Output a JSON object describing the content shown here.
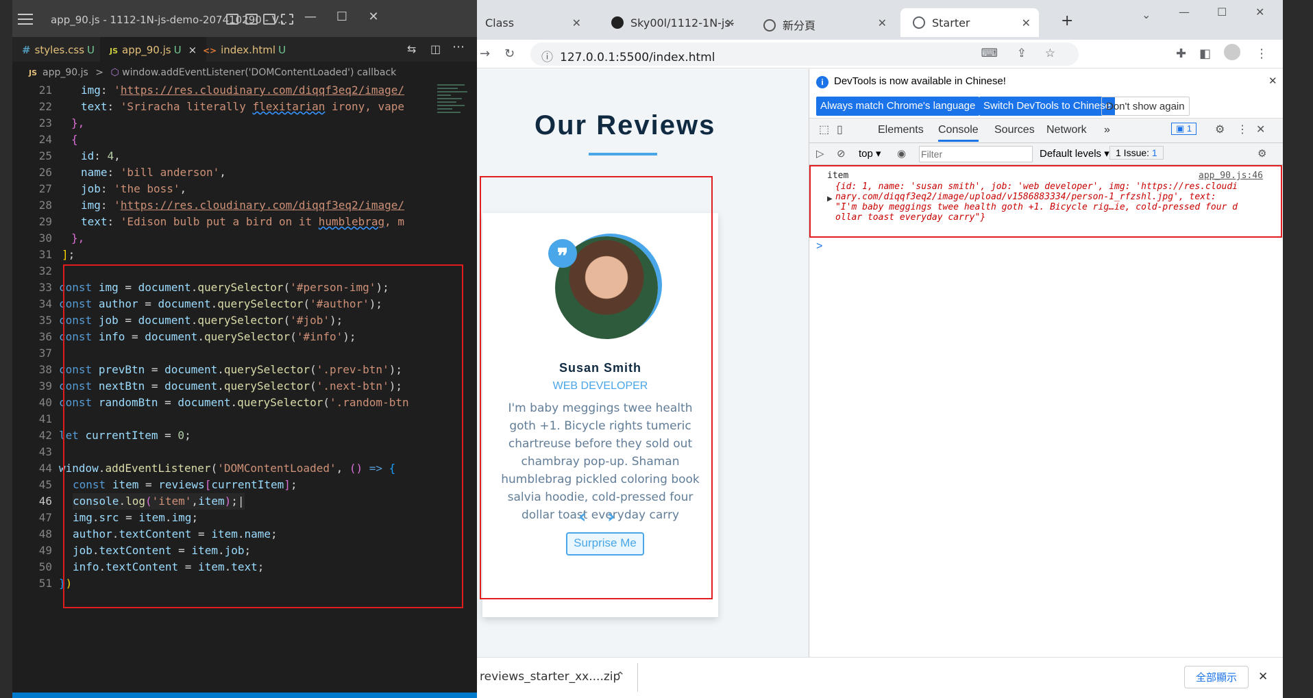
{
  "vscode": {
    "window_title": "app_90.js - 1112-1N-js-demo-207410290 - V...",
    "tabs": [
      {
        "icon": "#",
        "label": "styles.css",
        "status": "U"
      },
      {
        "icon": "JS",
        "label": "app_90.js",
        "status": "U",
        "close": "×"
      },
      {
        "icon": "<>",
        "label": "index.html",
        "status": "U"
      }
    ],
    "breadcrumb": {
      "file_icon": "JS",
      "file": "app_90.js",
      "sep": ">",
      "symbol": "window.addEventListener('DOMContentLoaded') callback"
    },
    "line_numbers": [
      "21",
      "22",
      "23",
      "24",
      "25",
      "26",
      "27",
      "28",
      "29",
      "30",
      "31",
      "32",
      "33",
      "34",
      "35",
      "36",
      "37",
      "38",
      "39",
      "40",
      "41",
      "42",
      "43",
      "44",
      "45",
      "46",
      "47",
      "48",
      "49",
      "50",
      "51"
    ],
    "current_line": "46"
  },
  "chrome": {
    "tabs": [
      {
        "label": "Class"
      },
      {
        "label": "Sky00l/1112-1N-js-"
      },
      {
        "label": "新分頁"
      },
      {
        "label": "Starter"
      }
    ],
    "new_tab": "+",
    "url": "127.0.0.1:5500/index.html"
  },
  "page": {
    "heading": "Our Reviews",
    "person": {
      "name": "Susan Smith",
      "job": "WEB DEVELOPER",
      "text": "I'm baby meggings twee health goth +1. Bicycle rights tumeric chartreuse before they sold out chambray pop-up. Shaman humblebrag pickled coloring book salvia hoodie, cold-pressed four dollar toast everyday carry"
    },
    "quote_icon": "❞",
    "prev_icon": "‹",
    "next_icon": "›",
    "surprise_label": "Surprise Me"
  },
  "devtools": {
    "info_message": "DevTools is now available in Chinese!",
    "btn_always_match": "Always match Chrome's language",
    "btn_switch": "Switch DevTools to Chinese",
    "btn_dont_show": "Don't show again",
    "tabs": [
      "Elements",
      "Console",
      "Sources",
      "Network",
      "»"
    ],
    "messages_badge": "1",
    "context": "top",
    "filter_placeholder": "Filter",
    "levels": "Default levels",
    "issues": "1 Issue:",
    "issues_badge": "1",
    "log_label": "item",
    "log_source": "app_90.js:46",
    "log_lines": [
      "{id: 1, name: 'susan smith', job: 'web developer', img: 'https://res.cloudi",
      "nary.com/diqqf3eq2/image/upload/v1586883334/person-1_rfzshl.jpg', text:",
      "\"I'm baby meggings twee health goth +1. Bicycle rig…ie, cold-pressed four d",
      "ollar toast everyday carry\"}"
    ],
    "prompt": ">"
  },
  "downloads": {
    "file": "reviews_starter_xx....zip",
    "show_all": "全部顯示"
  }
}
